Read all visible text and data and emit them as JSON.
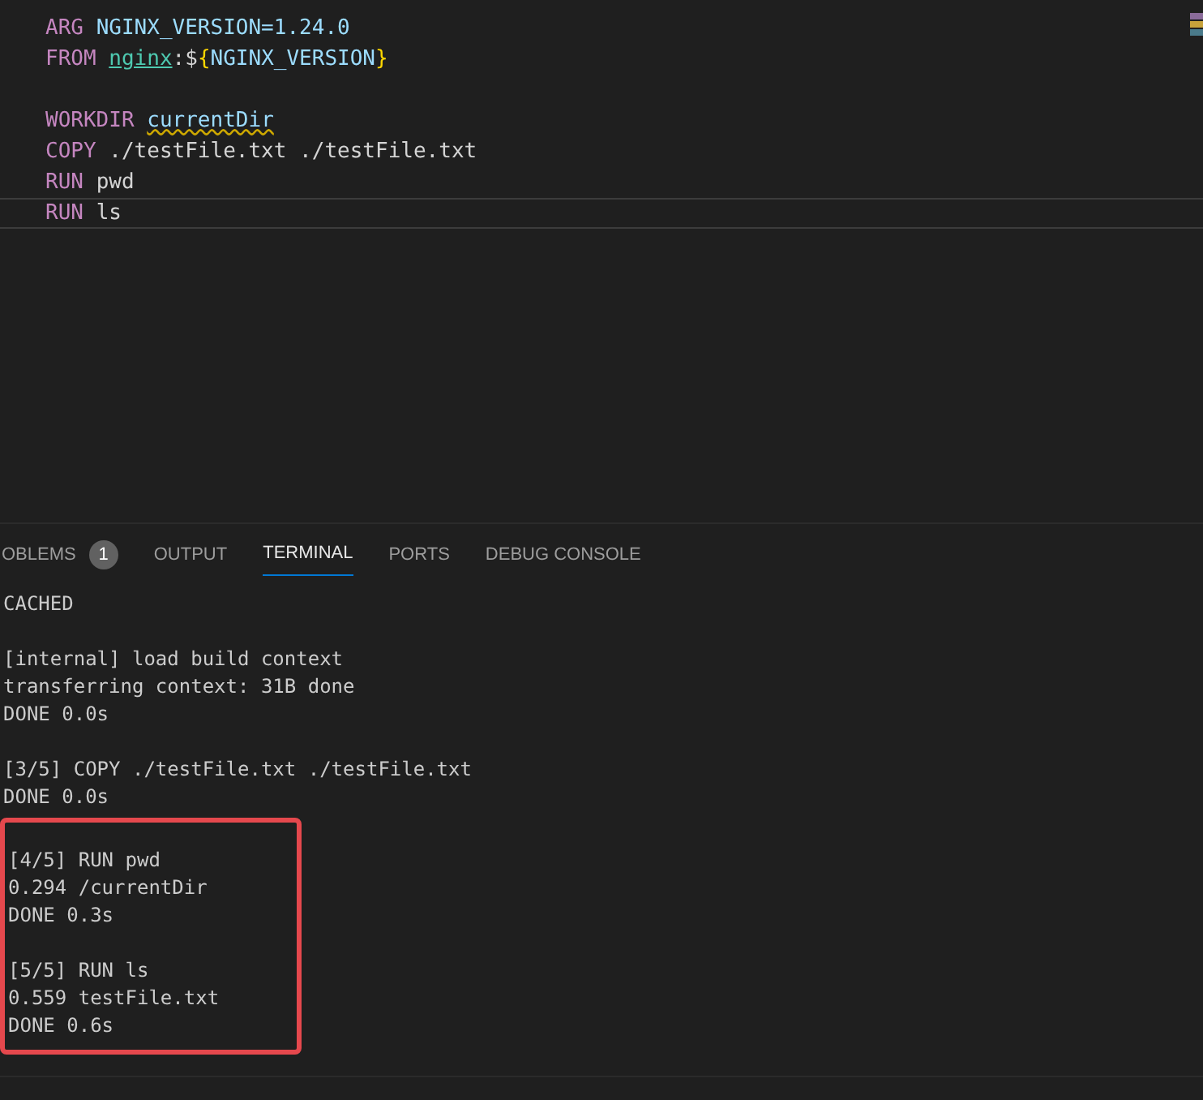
{
  "editor": {
    "lines": [
      {
        "current": false,
        "tokens": [
          {
            "text": "ARG ",
            "kind": "keyword"
          },
          {
            "text": "NGINX_VERSION=1.24.0",
            "kind": "variable"
          }
        ]
      },
      {
        "current": false,
        "tokens": [
          {
            "text": "FROM ",
            "kind": "keyword"
          },
          {
            "text": "nginx",
            "kind": "image"
          },
          {
            "text": ":$",
            "kind": "plain"
          },
          {
            "text": "{",
            "kind": "brace"
          },
          {
            "text": "NGINX_VERSION",
            "kind": "variable"
          },
          {
            "text": "}",
            "kind": "brace"
          }
        ]
      },
      {
        "current": false
      },
      {
        "current": false,
        "tokens": [
          {
            "text": "WORKDIR ",
            "kind": "keyword"
          },
          {
            "text": "currentDir",
            "kind": "warning"
          }
        ]
      },
      {
        "current": false,
        "tokens": [
          {
            "text": "COPY ",
            "kind": "keyword"
          },
          {
            "text": "./testFile.txt ./testFile.txt",
            "kind": "plain"
          }
        ]
      },
      {
        "current": false,
        "tokens": [
          {
            "text": "RUN ",
            "kind": "keyword"
          },
          {
            "text": "pwd",
            "kind": "plain"
          }
        ]
      },
      {
        "current": true,
        "tokens": [
          {
            "text": "RUN ",
            "kind": "keyword"
          },
          {
            "text": "ls",
            "kind": "plain"
          }
        ]
      }
    ]
  },
  "panel": {
    "tabs": [
      {
        "label": "OBLEMS",
        "badge": "1",
        "selected": false
      },
      {
        "label": "OUTPUT",
        "selected": false
      },
      {
        "label": "TERMINAL",
        "selected": true
      },
      {
        "label": "PORTS",
        "selected": false
      },
      {
        "label": "DEBUG CONSOLE",
        "selected": false
      }
    ],
    "terminal_blocks": [
      [
        "CACHED"
      ],
      [
        "[internal] load build context",
        "transferring context: 31B done",
        "DONE 0.0s"
      ],
      [
        "[3/5] COPY ./testFile.txt ./testFile.txt",
        "DONE 0.0s"
      ]
    ],
    "highlighted_blocks": [
      [
        "[4/5] RUN pwd",
        "0.294 /currentDir",
        "DONE 0.3s"
      ],
      [
        "[5/5] RUN ls",
        "0.559 testFile.txt",
        "DONE 0.6s"
      ]
    ]
  }
}
